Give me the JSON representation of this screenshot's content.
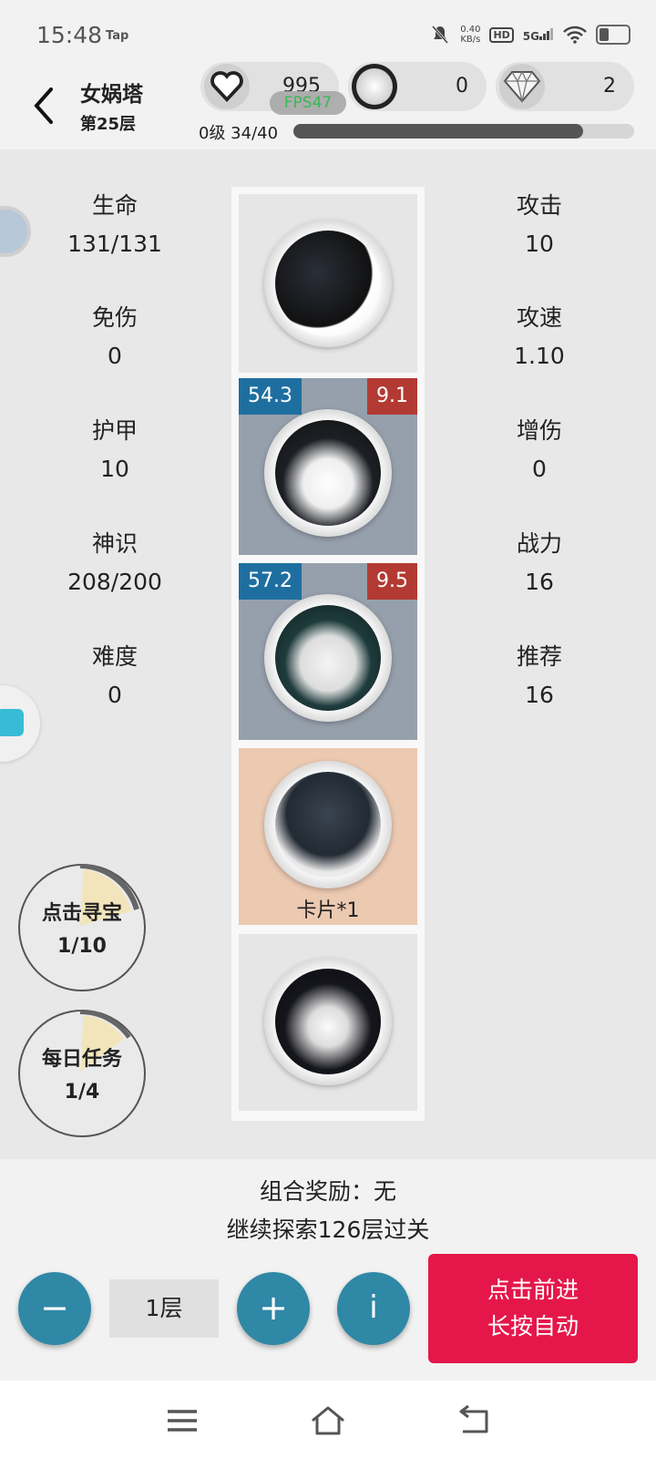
{
  "status": {
    "time": "15:48",
    "tap": "Tap",
    "net_speed_value": "0.40",
    "net_speed_unit": "KB/s",
    "hd": "HD",
    "network": "5G"
  },
  "header": {
    "title": "女娲塔",
    "subtitle": "第25层",
    "currencies": [
      {
        "icon": "heart-icon",
        "value": "995"
      },
      {
        "icon": "coin-icon",
        "value": "0"
      },
      {
        "icon": "diamond-icon",
        "value": "2"
      }
    ],
    "fps": "FPS47",
    "level_text": "0级 34/40",
    "level_progress": 0.85
  },
  "stats_left": [
    {
      "label": "生命",
      "value": "131/131"
    },
    {
      "label": "免伤",
      "value": "0"
    },
    {
      "label": "护甲",
      "value": "10"
    },
    {
      "label": "神识",
      "value": "208/200"
    },
    {
      "label": "难度",
      "value": "0"
    }
  ],
  "stats_right": [
    {
      "label": "攻击",
      "value": "10"
    },
    {
      "label": "攻速",
      "value": "1.10"
    },
    {
      "label": "增伤",
      "value": "0"
    },
    {
      "label": "战力",
      "value": "16"
    },
    {
      "label": "推荐",
      "value": "16"
    }
  ],
  "cards": [
    {
      "image": "stair-medal"
    },
    {
      "image": "fox-medal",
      "left_tag": "54.3",
      "right_tag": "9.1"
    },
    {
      "image": "dragon-medal",
      "left_tag": "57.2",
      "right_tag": "9.5"
    },
    {
      "image": "cloud-medal",
      "label": "卡片*1"
    },
    {
      "image": "girl-medal"
    }
  ],
  "side_buttons": [
    {
      "label": "点击寻宝",
      "progress": "1/10"
    },
    {
      "label": "每日任务",
      "progress": "1/4"
    }
  ],
  "footer": {
    "combo": "组合奖励：无",
    "explore": "继续探索126层过关",
    "minus": "−",
    "plus": "+",
    "info": "i",
    "floor": "1层",
    "go_line1": "点击前进",
    "go_line2": "长按自动"
  },
  "colors": {
    "accent_red": "#e5174a",
    "accent_teal": "#2f88a6",
    "tag_blue": "#1e6fa0",
    "tag_red": "#b33a33",
    "card_gray": "#96a0ac",
    "card_peach": "#ecc9b1"
  }
}
